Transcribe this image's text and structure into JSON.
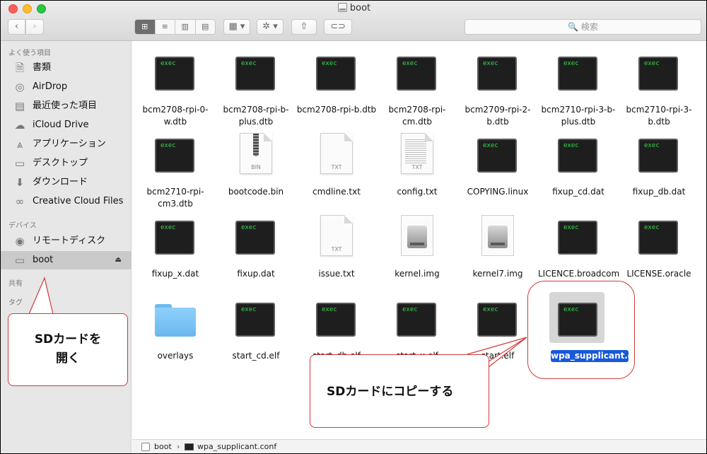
{
  "window": {
    "title": "boot"
  },
  "toolbar": {
    "back": "‹",
    "forward": "›",
    "views": [
      "⊞",
      "≡",
      "▥",
      "▤"
    ],
    "arrange": "▦ ▾",
    "action": "✲ ▾",
    "share": "⇧",
    "tag": "⊂⊃",
    "search_placeholder": "🔍 検索"
  },
  "sidebar": {
    "favorites_header": "よく使う項目",
    "favorites": [
      {
        "label": "書類",
        "icon": "document-icon",
        "glyph": "🗎"
      },
      {
        "label": "AirDrop",
        "icon": "airdrop-icon",
        "glyph": "◎"
      },
      {
        "label": "最近使った項目",
        "icon": "recents-icon",
        "glyph": "▤"
      },
      {
        "label": "iCloud Drive",
        "icon": "cloud-icon",
        "glyph": "☁"
      },
      {
        "label": "アプリケーション",
        "icon": "applications-icon",
        "glyph": "⩓"
      },
      {
        "label": "デスクトップ",
        "icon": "desktop-icon",
        "glyph": "▭"
      },
      {
        "label": "ダウンロード",
        "icon": "download-icon",
        "glyph": "⬇"
      },
      {
        "label": "Creative Cloud Files",
        "icon": "creative-cloud-icon",
        "glyph": "∞"
      }
    ],
    "devices_header": "デバイス",
    "devices": [
      {
        "label": "リモートディスク",
        "icon": "remote-disc-icon",
        "glyph": "◉"
      },
      {
        "label": "boot",
        "icon": "drive-icon",
        "glyph": "▭",
        "eject": "⏏"
      }
    ],
    "shared_header": "共有",
    "tags_header": "タグ"
  },
  "files": [
    {
      "name": "bcm2708-rpi-0-w.dtb",
      "kind": "exec",
      "label": "exec"
    },
    {
      "name": "bcm2708-rpi-b-plus.dtb",
      "kind": "exec",
      "label": "exec"
    },
    {
      "name": "bcm2708-rpi-b.dtb",
      "kind": "exec",
      "label": "exec"
    },
    {
      "name": "bcm2708-rpi-cm.dtb",
      "kind": "exec",
      "label": "exec"
    },
    {
      "name": "bcm2709-rpi-2-b.dtb",
      "kind": "exec",
      "label": "exec"
    },
    {
      "name": "bcm2710-rpi-3-b-plus.dtb",
      "kind": "exec",
      "label": "exec"
    },
    {
      "name": "bcm2710-rpi-3-b.dtb",
      "kind": "exec",
      "label": "exec"
    },
    {
      "name": "bcm2710-rpi-cm3.dtb",
      "kind": "exec",
      "label": "exec"
    },
    {
      "name": "bootcode.bin",
      "kind": "bin",
      "label": "BIN"
    },
    {
      "name": "cmdline.txt",
      "kind": "txt",
      "label": "TXT"
    },
    {
      "name": "config.txt",
      "kind": "txtlines",
      "label": "TXT"
    },
    {
      "name": "COPYING.linux",
      "kind": "exec",
      "label": "exec"
    },
    {
      "name": "fixup_cd.dat",
      "kind": "exec",
      "label": "exec"
    },
    {
      "name": "fixup_db.dat",
      "kind": "exec",
      "label": "exec"
    },
    {
      "name": "fixup_x.dat",
      "kind": "exec",
      "label": "exec"
    },
    {
      "name": "fixup.dat",
      "kind": "exec",
      "label": "exec"
    },
    {
      "name": "issue.txt",
      "kind": "txt",
      "label": "TXT"
    },
    {
      "name": "kernel.img",
      "kind": "disk",
      "label": ""
    },
    {
      "name": "kernel7.img",
      "kind": "disk",
      "label": ""
    },
    {
      "name": "LICENCE.broadcom",
      "kind": "exec",
      "label": "exec"
    },
    {
      "name": "LICENSE.oracle",
      "kind": "exec",
      "label": "exec"
    },
    {
      "name": "overlays",
      "kind": "folder",
      "label": ""
    },
    {
      "name": "start_cd.elf",
      "kind": "exec",
      "label": "exec"
    },
    {
      "name": "start_db.elf",
      "kind": "exec",
      "label": "exec"
    },
    {
      "name": "start_x.elf",
      "kind": "exec",
      "label": "exec"
    },
    {
      "name": "start.elf",
      "kind": "exec",
      "label": "exec"
    },
    {
      "name": "wpa_supplicant.conf",
      "kind": "exec",
      "label": "exec",
      "selected": true
    }
  ],
  "pathbar": {
    "drive": "boot",
    "separator": "›",
    "file": "wpa_supplicant.conf"
  },
  "annotations": {
    "open_sd": "SDカードを\n開く",
    "copy_sd": "SDカードにコピーする",
    "color": "#d23a3a"
  }
}
